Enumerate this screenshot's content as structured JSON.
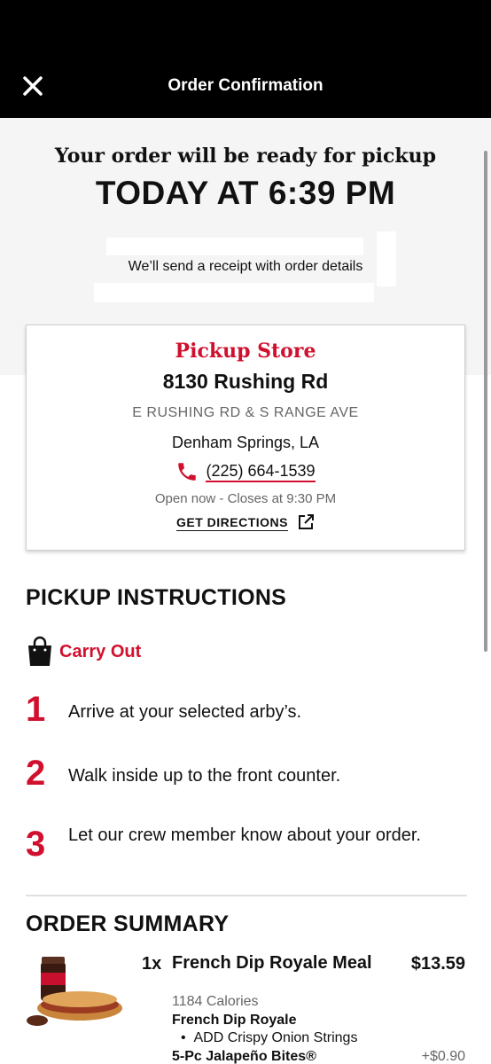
{
  "header": {
    "title": "Order Confirmation",
    "close_icon": "close-icon"
  },
  "hero": {
    "subtitle": "Your order will be ready for pickup",
    "time": "TODAY AT 6:39 PM",
    "receipt_note": "We’ll send a receipt with order details"
  },
  "store": {
    "label": "Pickup Store",
    "name": "8130 Rushing Rd",
    "cross_streets": "E RUSHING RD & S RANGE AVE",
    "city": "Denham Springs, LA",
    "phone": "(225) 664-1539",
    "hours": "Open now - Closes at 9:30 PM",
    "directions_label": "GET DIRECTIONS",
    "phone_icon": "phone-icon",
    "directions_icon": "external-link-icon"
  },
  "instructions": {
    "title": "PICKUP INSTRUCTIONS",
    "method_label": "Carry Out",
    "method_icon": "shopping-bag-icon",
    "steps": [
      {
        "number": "1",
        "text": "Arrive at your selected arby’s."
      },
      {
        "number": "2",
        "text": "Walk inside up to the front counter."
      },
      {
        "number": "3",
        "text": "Let our crew member know about your order."
      }
    ]
  },
  "summary": {
    "title": "ORDER SUMMARY",
    "items": [
      {
        "qty": "1x",
        "name": "French Dip Royale Meal",
        "price": "$13.59",
        "calories": "1184 Calories",
        "modifiers": [
          {
            "title": "French Dip Royale",
            "options": [
              "ADD Crispy Onion Strings"
            ]
          },
          {
            "title": "5-Pc Jalapeño Bites®",
            "price": "+$0.90"
          }
        ]
      }
    ]
  },
  "colors": {
    "brand_red": "#d0102e",
    "header_bg": "#000000",
    "hero_bg": "#f5f5f5"
  }
}
